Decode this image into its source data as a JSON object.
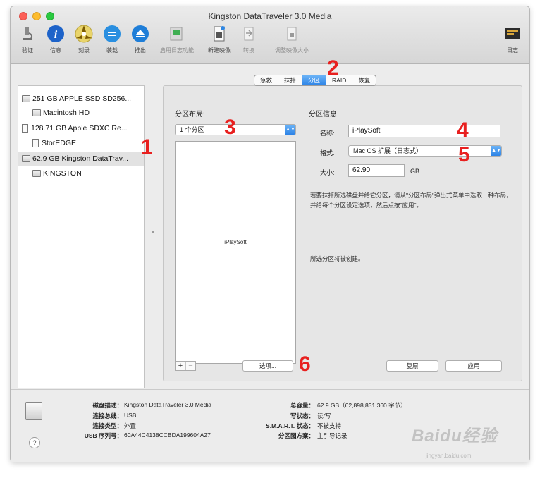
{
  "window": {
    "title": "Kingston DataTraveler 3.0 Media"
  },
  "toolbar": {
    "items": [
      {
        "label": "验证",
        "icon": "microscope-icon",
        "color": "#8a8a8a"
      },
      {
        "label": "信息",
        "icon": "info-icon",
        "color": "#1e63c9"
      },
      {
        "label": "刻录",
        "icon": "burn-icon",
        "color": "#d9b100"
      },
      {
        "label": "装载",
        "icon": "mount-icon",
        "color": "#2a8fe0"
      },
      {
        "label": "推出",
        "icon": "eject-icon",
        "color": "#1f7ed8"
      },
      {
        "label": "启用日志功能",
        "icon": "journal-icon",
        "color": "#9c9c9c"
      },
      {
        "label": "新建映像",
        "icon": "new-image-icon",
        "color": "#7a7a7a"
      },
      {
        "label": "转换",
        "icon": "convert-icon",
        "color": "#a8a8a8"
      },
      {
        "label": "调整映像大小",
        "icon": "resize-image-icon",
        "color": "#a8a8a8"
      }
    ],
    "log_label": "日志"
  },
  "sidebar": {
    "devices": [
      {
        "label": "251 GB APPLE SSD SD256...",
        "kind": "disk"
      },
      {
        "label": "Macintosh HD",
        "kind": "volume"
      },
      {
        "label": "128.71 GB Apple SDXC Re...",
        "kind": "disk"
      },
      {
        "label": "StorEDGE",
        "kind": "volume"
      },
      {
        "label": "62.9 GB Kingston DataTrav...",
        "kind": "disk",
        "selected": true
      },
      {
        "label": "KINGSTON",
        "kind": "volume"
      }
    ]
  },
  "tabs": [
    "急救",
    "抹掉",
    "分区",
    "RAID",
    "恢复"
  ],
  "active_tab": "分区",
  "partition": {
    "layout_title": "分区布局:",
    "layout_selected": "1 个分区",
    "part_name": "iPlaySoft",
    "info_title": "分区信息",
    "name_label": "名称:",
    "name_value": "iPlaySoft",
    "format_label": "格式:",
    "format_value": "Mac OS 扩展（日志式）",
    "size_label": "大小:",
    "size_value": "62.90",
    "size_unit": "GB",
    "instructions": "若要抹掉所选磁盘并给它分区，请从\"分区布局\"弹出式菜单中选取一种布局，并给每个分区设定选项，然后点按\"应用\"。",
    "status_text": "所选分区将被创建。",
    "options_button": "选项...",
    "revert_button": "复原",
    "apply_button": "应用"
  },
  "badges": [
    "1",
    "2",
    "3",
    "4",
    "5",
    "6"
  ],
  "details": {
    "left": [
      {
        "key": "磁盘描述：",
        "value": "Kingston DataTraveler 3.0 Media"
      },
      {
        "key": "连接总线：",
        "value": "USB"
      },
      {
        "key": "连接类型：",
        "value": "外置"
      },
      {
        "key": "USB 序列号：",
        "value": "60A44C4138CCBDA199604A27"
      }
    ],
    "right": [
      {
        "key": "总容量：",
        "value": "62.9 GB（62,898,831,360 字节）"
      },
      {
        "key": "写状态：",
        "value": "读/写"
      },
      {
        "key": "S.M.A.R.T. 状态：",
        "value": "不被支持"
      },
      {
        "key": "分区图方案：",
        "value": "主引导记录"
      }
    ]
  },
  "watermark": {
    "text": "Baidu经验",
    "sub": "jingyan.baidu.com"
  }
}
